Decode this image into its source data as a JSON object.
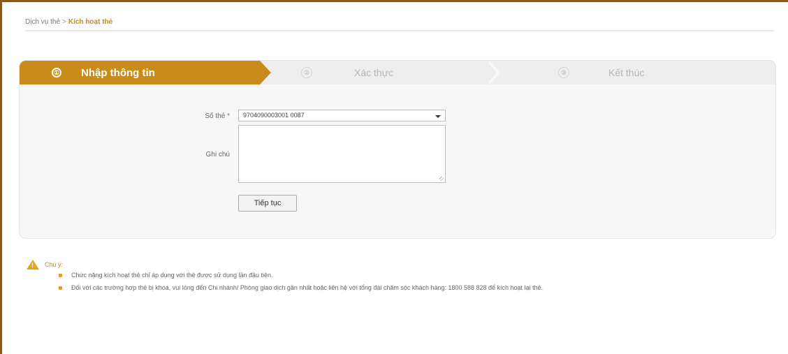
{
  "breadcrumb": {
    "parent": "Dịch vụ thẻ",
    "separator": ">",
    "current": "Kích hoạt thẻ"
  },
  "steps": [
    {
      "number": "①",
      "label": "Nhập thông tin",
      "active": true
    },
    {
      "number": "②",
      "label": "Xác thực",
      "active": false
    },
    {
      "number": "③",
      "label": "Kết thúc",
      "active": false
    }
  ],
  "form": {
    "card_label": "Số thẻ",
    "required_mark": "*",
    "card_value": "9704090003001 0087",
    "note_label": "Ghi chú",
    "note_value": "",
    "continue_button": "Tiếp tục"
  },
  "notice": {
    "title": "Chú ý:",
    "items": [
      "Chức năng kích hoạt thẻ chỉ áp dụng với thẻ được sử dụng lần đầu tiên.",
      "Đối với các trường hợp thẻ bị khoá, vui lòng đến Chi nhánh/ Phòng giao dịch gần nhất hoặc liên hệ với tổng đài chăm sóc khách hàng: 1800 588 828 để kích hoạt lại thẻ."
    ]
  },
  "colors": {
    "accent": "#c98b1a",
    "frame": "#8b5a23",
    "warning": "#e8a317"
  },
  "icons": {
    "warning": "warning-triangle-icon",
    "dropdown": "chevron-down-icon"
  }
}
